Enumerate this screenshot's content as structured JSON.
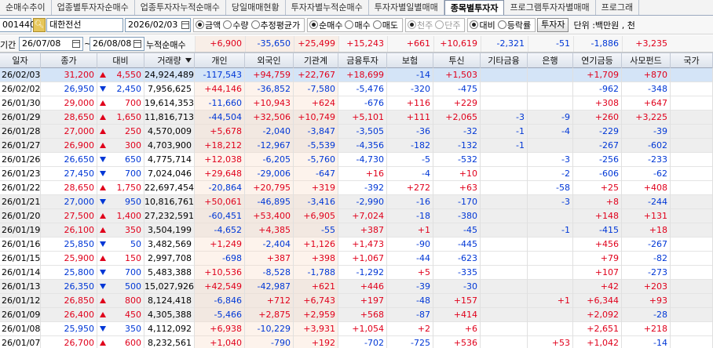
{
  "tabs": [
    {
      "label": "순매수추이",
      "active": false
    },
    {
      "label": "업종별투자자순매수",
      "active": false
    },
    {
      "label": "업종투자자누적순매수",
      "active": false
    },
    {
      "label": "당일매매현황",
      "active": false
    },
    {
      "label": "투자자별누적순매수",
      "active": false
    },
    {
      "label": "투자자별일별매매",
      "active": false
    },
    {
      "label": "종목별투자자",
      "active": true
    },
    {
      "label": "프로그램투자자별매매",
      "active": false
    },
    {
      "label": "프로그래",
      "active": false
    }
  ],
  "toolbar": {
    "stock_code": "001440",
    "search_icon": "search-icon",
    "stock_name": "대한전선",
    "date": "2026/02/03",
    "amount_group": [
      {
        "label": "금액",
        "checked": true
      },
      {
        "label": "수량",
        "checked": false
      },
      {
        "label": "추정평균가",
        "checked": false
      }
    ],
    "trade_group": [
      {
        "label": "순매수",
        "checked": true
      },
      {
        "label": "매수",
        "checked": false
      },
      {
        "label": "매도",
        "checked": false
      }
    ],
    "unit_group": [
      {
        "label": "천주",
        "checked": true,
        "disabled": true
      },
      {
        "label": "단주",
        "checked": false,
        "disabled": true
      }
    ],
    "compare_group": [
      {
        "label": "대비",
        "checked": true
      },
      {
        "label": "등락률",
        "checked": false
      }
    ],
    "investor_button": "투자자",
    "unit_label": "단위 :백만원 , 천"
  },
  "period": {
    "label": "기간",
    "start": "26/07/08",
    "tilde": "~",
    "end": "26/08/08",
    "cumulative_label": "누적순매수"
  },
  "totals": {
    "individual": "+6,900",
    "foreign": "-35,650",
    "institution": "+25,499",
    "financial": "+15,243",
    "insurance": "+661",
    "trust": "+10,619",
    "other_fin": "-2,321",
    "bank": "-51",
    "pension": "-1,886",
    "private_fund": "+3,235"
  },
  "columns": [
    "일자",
    "종가",
    "대비",
    "거래량",
    "개인",
    "외국인",
    "기관계",
    "금융투자",
    "보험",
    "투신",
    "기타금융",
    "은행",
    "연기금등",
    "사모펀드",
    "국가"
  ],
  "colors": {
    "up": "#e0001b",
    "down": "#0037d6",
    "selected": "#d4e4f7"
  },
  "rows": [
    {
      "date": "26/02/03",
      "close": "31,200",
      "dir": "up",
      "change": "4,550",
      "volume": "24,924,489",
      "individual": "-117,543",
      "foreign": "+94,759",
      "institution": "+22,767",
      "financial": "+18,699",
      "insurance": "-14",
      "trust": "+1,503",
      "other_fin": "",
      "bank": "",
      "pension": "+1,709",
      "private_fund": "+870",
      "nation": ""
    },
    {
      "date": "26/02/02",
      "close": "26,950",
      "dir": "down",
      "change": "2,450",
      "volume": "7,956,625",
      "individual": "+44,146",
      "foreign": "-36,852",
      "institution": "-7,580",
      "financial": "-5,476",
      "insurance": "-320",
      "trust": "-475",
      "other_fin": "",
      "bank": "",
      "pension": "-962",
      "private_fund": "-348",
      "nation": ""
    },
    {
      "date": "26/01/30",
      "close": "29,000",
      "dir": "up",
      "change": "700",
      "volume": "19,614,353",
      "individual": "-11,660",
      "foreign": "+10,943",
      "institution": "+624",
      "financial": "-676",
      "insurance": "+116",
      "trust": "+229",
      "other_fin": "",
      "bank": "",
      "pension": "+308",
      "private_fund": "+647",
      "nation": ""
    },
    {
      "date": "26/01/29",
      "close": "28,650",
      "dir": "up",
      "change": "1,650",
      "volume": "11,816,713",
      "individual": "-44,504",
      "foreign": "+32,506",
      "institution": "+10,749",
      "financial": "+5,101",
      "insurance": "+111",
      "trust": "+2,065",
      "other_fin": "-3",
      "bank": "-9",
      "pension": "+260",
      "private_fund": "+3,225",
      "nation": ""
    },
    {
      "date": "26/01/28",
      "close": "27,000",
      "dir": "up",
      "change": "250",
      "volume": "4,570,009",
      "individual": "+5,678",
      "foreign": "-2,040",
      "institution": "-3,847",
      "financial": "-3,505",
      "insurance": "-36",
      "trust": "-32",
      "other_fin": "-1",
      "bank": "-4",
      "pension": "-229",
      "private_fund": "-39",
      "nation": ""
    },
    {
      "date": "26/01/27",
      "close": "26,900",
      "dir": "up",
      "change": "300",
      "volume": "4,703,900",
      "individual": "+18,212",
      "foreign": "-12,967",
      "institution": "-5,539",
      "financial": "-4,356",
      "insurance": "-182",
      "trust": "-132",
      "other_fin": "-1",
      "bank": "",
      "pension": "-267",
      "private_fund": "-602",
      "nation": ""
    },
    {
      "date": "26/01/26",
      "close": "26,650",
      "dir": "down",
      "change": "650",
      "volume": "4,775,714",
      "individual": "+12,038",
      "foreign": "-6,205",
      "institution": "-5,760",
      "financial": "-4,730",
      "insurance": "-5",
      "trust": "-532",
      "other_fin": "",
      "bank": "-3",
      "pension": "-256",
      "private_fund": "-233",
      "nation": ""
    },
    {
      "date": "26/01/23",
      "close": "27,450",
      "dir": "down",
      "change": "700",
      "volume": "7,024,046",
      "individual": "+29,648",
      "foreign": "-29,006",
      "institution": "-647",
      "financial": "+16",
      "insurance": "-4",
      "trust": "+10",
      "other_fin": "",
      "bank": "-2",
      "pension": "-606",
      "private_fund": "-62",
      "nation": ""
    },
    {
      "date": "26/01/22",
      "close": "28,650",
      "dir": "up",
      "change": "1,750",
      "volume": "22,697,454",
      "individual": "-20,864",
      "foreign": "+20,795",
      "institution": "+319",
      "financial": "-392",
      "insurance": "+272",
      "trust": "+63",
      "other_fin": "",
      "bank": "-58",
      "pension": "+25",
      "private_fund": "+408",
      "nation": ""
    },
    {
      "date": "26/01/21",
      "close": "27,000",
      "dir": "down",
      "change": "950",
      "volume": "10,816,761",
      "individual": "+50,061",
      "foreign": "-46,895",
      "institution": "-3,416",
      "financial": "-2,990",
      "insurance": "-16",
      "trust": "-170",
      "other_fin": "",
      "bank": "-3",
      "pension": "+8",
      "private_fund": "-244",
      "nation": ""
    },
    {
      "date": "26/01/20",
      "close": "27,500",
      "dir": "up",
      "change": "1,400",
      "volume": "27,232,591",
      "individual": "-60,451",
      "foreign": "+53,400",
      "institution": "+6,905",
      "financial": "+7,024",
      "insurance": "-18",
      "trust": "-380",
      "other_fin": "",
      "bank": "",
      "pension": "+148",
      "private_fund": "+131",
      "nation": ""
    },
    {
      "date": "26/01/19",
      "close": "26,100",
      "dir": "up",
      "change": "350",
      "volume": "3,504,199",
      "individual": "-4,652",
      "foreign": "+4,385",
      "institution": "-55",
      "financial": "+387",
      "insurance": "+1",
      "trust": "-45",
      "other_fin": "",
      "bank": "-1",
      "pension": "-415",
      "private_fund": "+18",
      "nation": ""
    },
    {
      "date": "26/01/16",
      "close": "25,850",
      "dir": "down",
      "change": "50",
      "volume": "3,482,569",
      "individual": "+1,249",
      "foreign": "-2,404",
      "institution": "+1,126",
      "financial": "+1,473",
      "insurance": "-90",
      "trust": "-445",
      "other_fin": "",
      "bank": "",
      "pension": "+456",
      "private_fund": "-267",
      "nation": ""
    },
    {
      "date": "26/01/15",
      "close": "25,900",
      "dir": "up",
      "change": "150",
      "volume": "2,997,708",
      "individual": "-698",
      "foreign": "+387",
      "institution": "+398",
      "financial": "+1,067",
      "insurance": "-44",
      "trust": "-623",
      "other_fin": "",
      "bank": "",
      "pension": "+79",
      "private_fund": "-82",
      "nation": ""
    },
    {
      "date": "26/01/14",
      "close": "25,800",
      "dir": "down",
      "change": "700",
      "volume": "5,483,388",
      "individual": "+10,536",
      "foreign": "-8,528",
      "institution": "-1,788",
      "financial": "-1,292",
      "insurance": "+5",
      "trust": "-335",
      "other_fin": "",
      "bank": "",
      "pension": "+107",
      "private_fund": "-273",
      "nation": ""
    },
    {
      "date": "26/01/13",
      "close": "26,350",
      "dir": "down",
      "change": "500",
      "volume": "15,027,926",
      "individual": "+42,549",
      "foreign": "-42,987",
      "institution": "+621",
      "financial": "+446",
      "insurance": "-39",
      "trust": "-30",
      "other_fin": "",
      "bank": "",
      "pension": "+42",
      "private_fund": "+203",
      "nation": ""
    },
    {
      "date": "26/01/12",
      "close": "26,850",
      "dir": "up",
      "change": "800",
      "volume": "8,124,418",
      "individual": "-6,846",
      "foreign": "+712",
      "institution": "+6,743",
      "financial": "+197",
      "insurance": "-48",
      "trust": "+157",
      "other_fin": "",
      "bank": "+1",
      "pension": "+6,344",
      "private_fund": "+93",
      "nation": ""
    },
    {
      "date": "26/01/09",
      "close": "26,400",
      "dir": "up",
      "change": "450",
      "volume": "4,305,388",
      "individual": "-5,466",
      "foreign": "+2,875",
      "institution": "+2,959",
      "financial": "+568",
      "insurance": "-87",
      "trust": "+414",
      "other_fin": "",
      "bank": "",
      "pension": "+2,092",
      "private_fund": "-28",
      "nation": ""
    },
    {
      "date": "26/01/08",
      "close": "25,950",
      "dir": "down",
      "change": "350",
      "volume": "4,112,092",
      "individual": "+6,938",
      "foreign": "-10,229",
      "institution": "+3,931",
      "financial": "+1,054",
      "insurance": "+2",
      "trust": "+6",
      "other_fin": "",
      "bank": "",
      "pension": "+2,651",
      "private_fund": "+218",
      "nation": ""
    },
    {
      "date": "26/01/07",
      "close": "26,700",
      "dir": "up",
      "change": "600",
      "volume": "8,232,561",
      "individual": "+1,040",
      "foreign": "-790",
      "institution": "+192",
      "financial": "-702",
      "insurance": "-725",
      "trust": "+536",
      "other_fin": "",
      "bank": "+53",
      "pension": "+1,042",
      "private_fund": "-14",
      "nation": ""
    }
  ]
}
